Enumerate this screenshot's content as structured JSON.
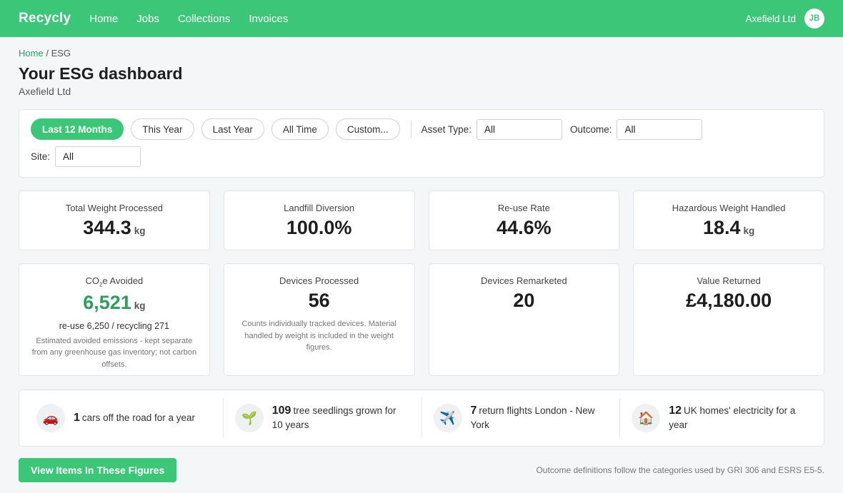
{
  "nav": {
    "brand": "Recycly",
    "links": [
      "Home",
      "Jobs",
      "Collections",
      "Invoices"
    ],
    "org": "Axefield Ltd",
    "avatar_initials": "JB"
  },
  "breadcrumb": {
    "home": "Home",
    "separator": "/",
    "current": "ESG"
  },
  "page": {
    "title": "Your ESG dashboard",
    "subtitle": "Axefield Ltd"
  },
  "filters": {
    "periods": [
      "Last 12 Months",
      "This Year",
      "Last Year",
      "All Time",
      "Custom..."
    ],
    "active_period": "Last 12 Months",
    "asset_type": {
      "label": "Asset Type:",
      "value": "All"
    },
    "outcome": {
      "label": "Outcome:",
      "value": "All"
    },
    "site": {
      "label": "Site:",
      "value": "All"
    }
  },
  "stats": {
    "total_weight": {
      "label": "Total Weight Processed",
      "value": "344.3",
      "unit": "kg"
    },
    "landfill": {
      "label": "Landfill Diversion",
      "value": "100.0%"
    },
    "reuse": {
      "label": "Re-use Rate",
      "value": "44.6%"
    },
    "hazardous": {
      "label": "Hazardous Weight Handled",
      "value": "18.4",
      "unit": "kg"
    },
    "co2": {
      "label_prefix": "CO",
      "label_sub": "2",
      "label_suffix": "e Avoided",
      "value": "6,521",
      "unit": "kg",
      "detail": "re-use 6,250 / recycling 271",
      "note": "Estimated avoided emissions - kept separate from any greenhouse gas inventory; not carbon offsets."
    },
    "devices_processed": {
      "label": "Devices Processed",
      "value": "56",
      "note": "Counts individually tracked devices. Material handled by weight is included in the weight figures."
    },
    "devices_remarketed": {
      "label": "Devices Remarketed",
      "value": "20"
    },
    "value_returned": {
      "label": "Value Returned",
      "value": "£4,180.00"
    }
  },
  "equivalents": [
    {
      "icon": "car-icon",
      "glyph": "🚗",
      "number": "1",
      "text": "cars off the road for a year"
    },
    {
      "icon": "seedling-icon",
      "glyph": "🌱",
      "number": "109",
      "text": "tree seedlings grown for 10 years"
    },
    {
      "icon": "airplane-icon",
      "glyph": "✈️",
      "number": "7",
      "text": "return flights London - New York"
    },
    {
      "icon": "house-icon",
      "glyph": "🏠",
      "number": "12",
      "text": "UK homes' electricity for a year"
    }
  ],
  "footer": {
    "button": "View Items In These Figures",
    "note": "Outcome definitions follow the categories used by GRI 306 and ESRS E5-5."
  },
  "colors": {
    "accent": "#3cc677",
    "accent_text": "#2e9e5e"
  }
}
